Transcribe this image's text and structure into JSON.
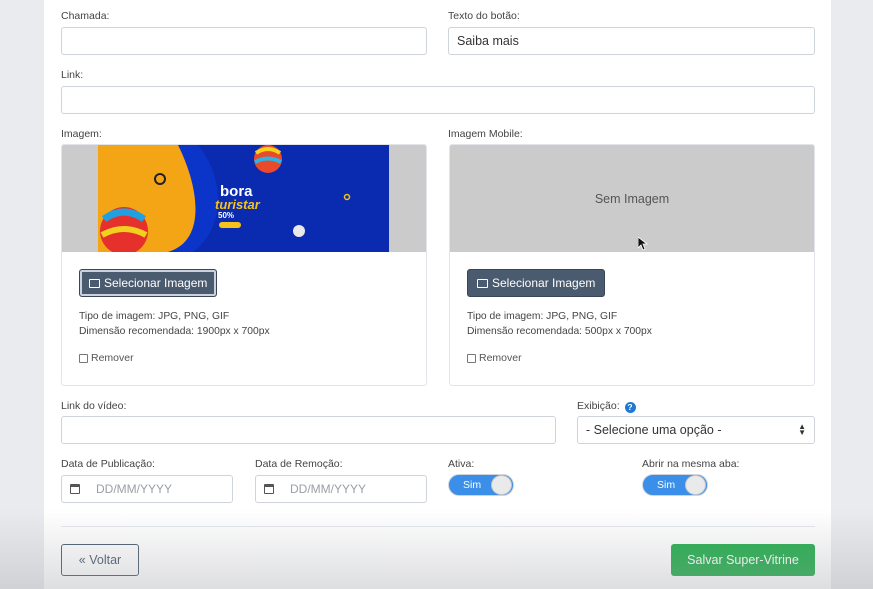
{
  "chamada": {
    "label": "Chamada:",
    "value": ""
  },
  "texto_botao": {
    "label": "Texto do botão:",
    "value": "Saiba mais"
  },
  "link": {
    "label": "Link:",
    "value": ""
  },
  "imagem": {
    "label": "Imagem:",
    "banner_text": {
      "line1": "bora",
      "line2": "turistar",
      "line3": "50%",
      "badge": ""
    },
    "select_button": "Selecionar Imagem",
    "tipo": "Tipo de imagem: JPG, PNG, GIF",
    "dimensao": "Dimensão recomendada: 1900px x 700px",
    "remover": "Remover"
  },
  "imagem_mobile": {
    "label": "Imagem Mobile:",
    "placeholder": "Sem Imagem",
    "select_button": "Selecionar Imagem",
    "tipo": "Tipo de imagem: JPG, PNG, GIF",
    "dimensao": "Dimensão recomendada: 500px x 700px",
    "remover": "Remover"
  },
  "link_video": {
    "label": "Link do vídeo:",
    "value": ""
  },
  "exibicao": {
    "label": "Exibição:",
    "selected": "- Selecione uma opção -",
    "help_icon": "question-circle-icon"
  },
  "data_publicacao": {
    "label": "Data de Publicação:",
    "placeholder": "DD/MM/YYYY"
  },
  "data_remocao": {
    "label": "Data de Remoção:",
    "placeholder": "DD/MM/YYYY"
  },
  "ativa": {
    "label": "Ativa:",
    "toggle_text": "Sim",
    "on": true
  },
  "mesma_aba": {
    "label": "Abrir na mesma aba:",
    "toggle_text": "Sim",
    "on": true
  },
  "actions": {
    "back": "« Voltar",
    "save": "Salvar Super-Vitrine"
  },
  "colors": {
    "accent": "#3b8fe8",
    "save": "#22ad4b",
    "dark_button": "#4a5a6f"
  }
}
